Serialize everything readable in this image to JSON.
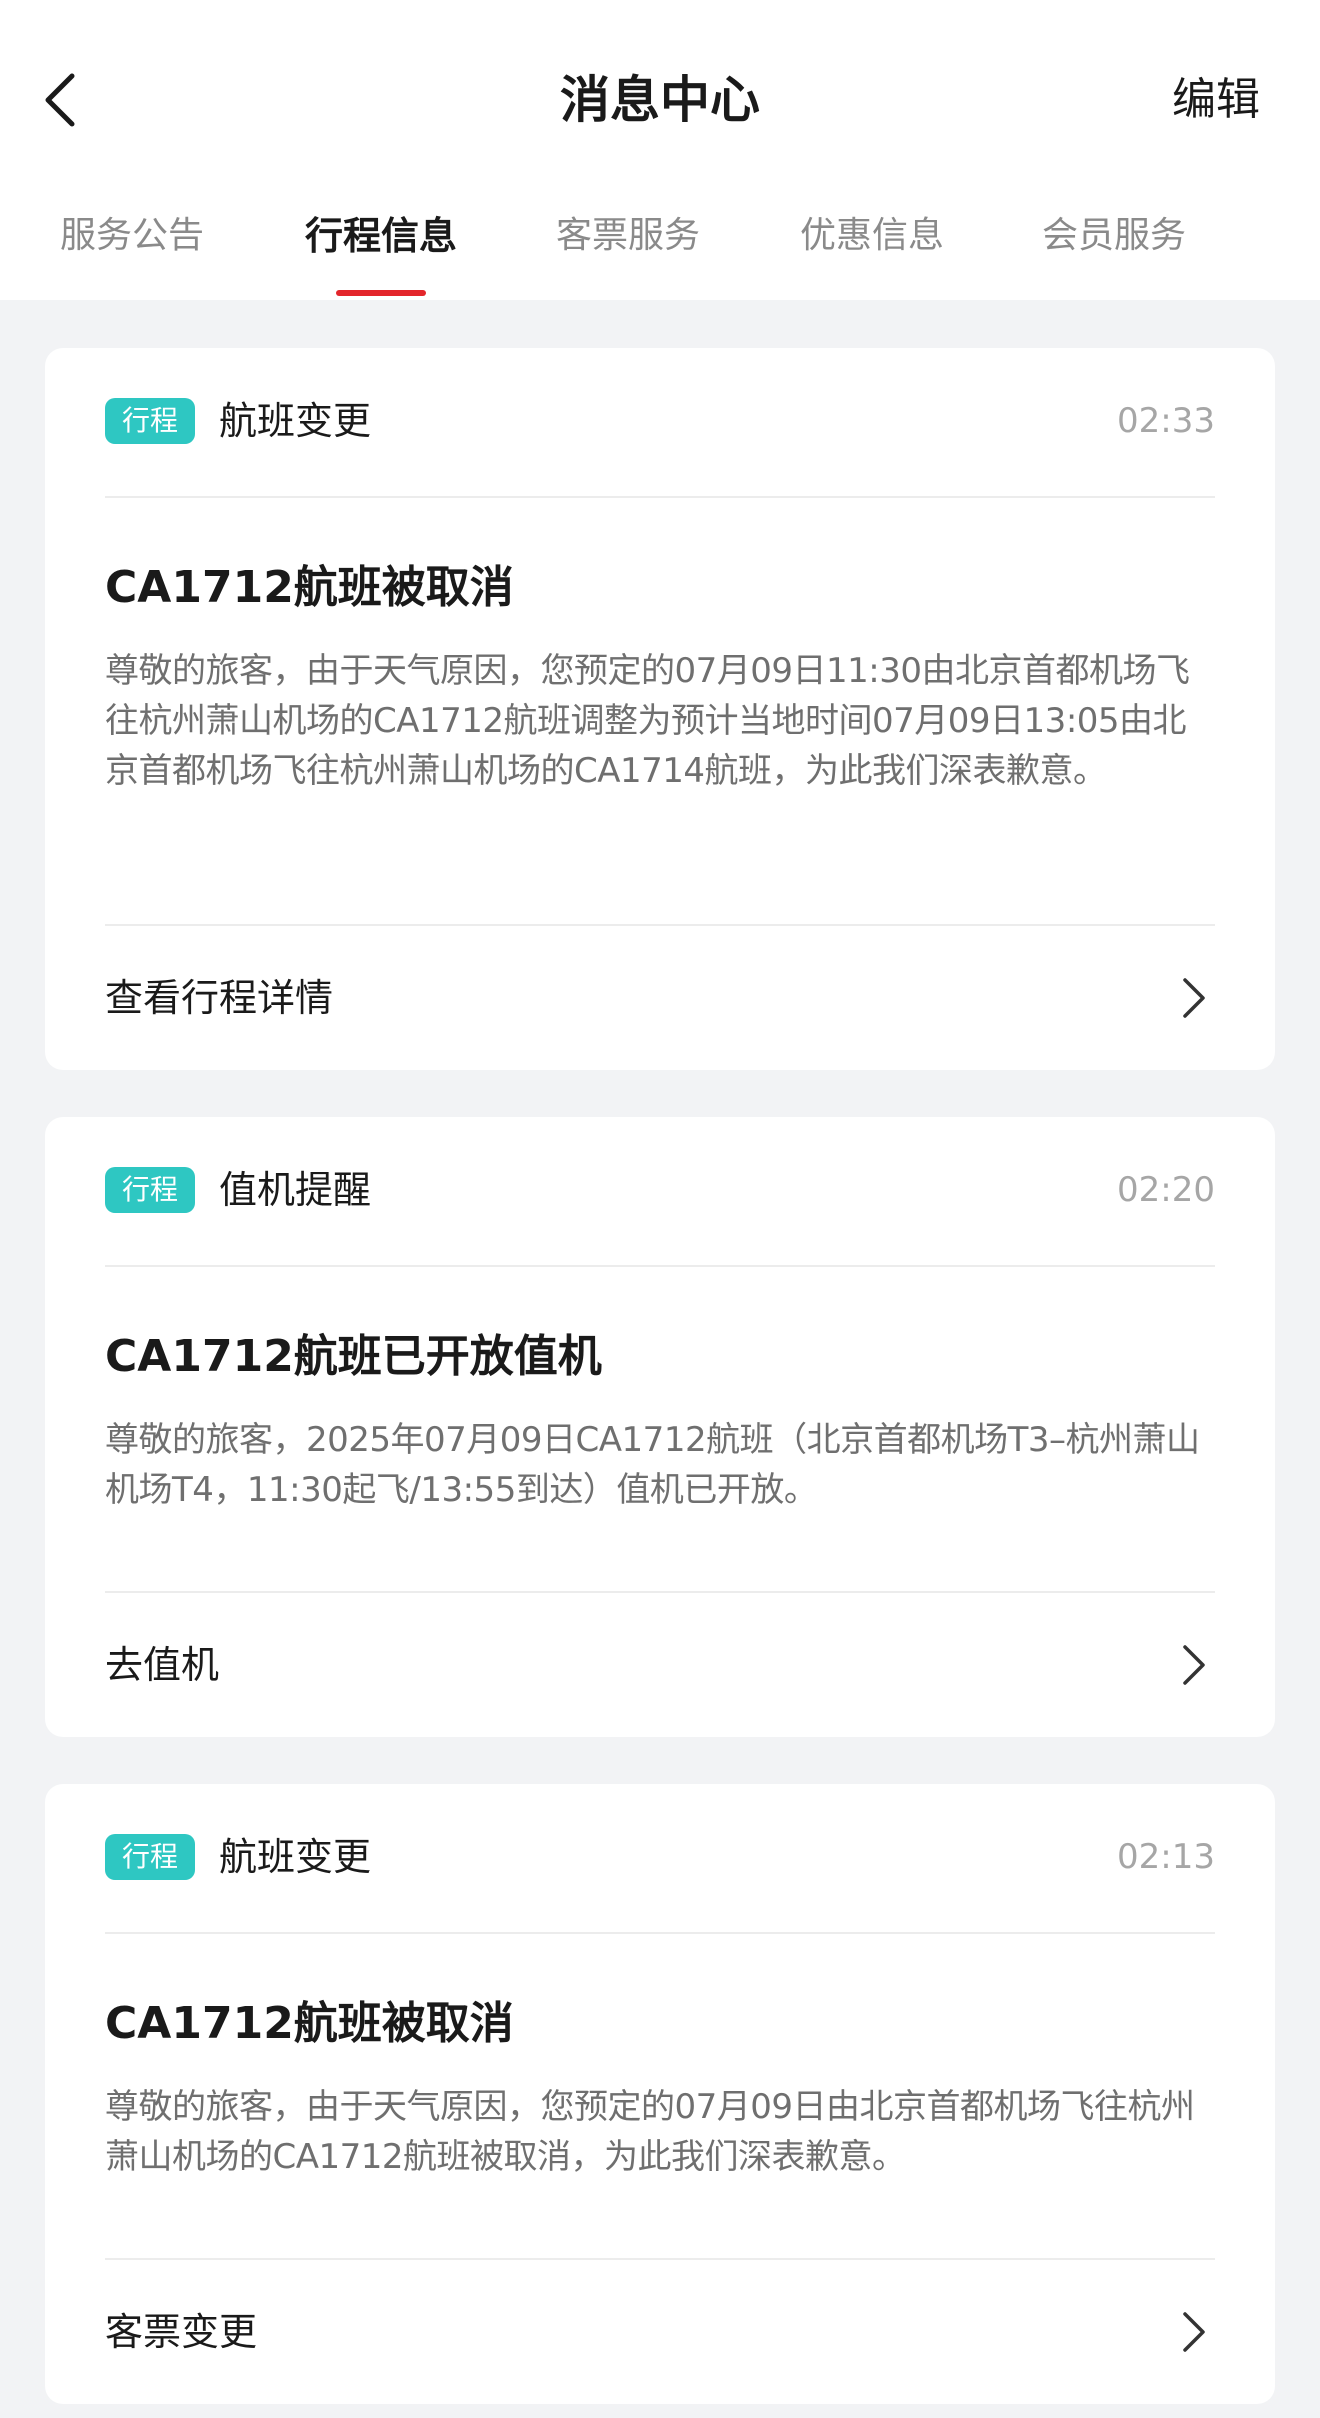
{
  "header": {
    "title": "消息中心",
    "edit_label": "编辑",
    "back_icon": "chevron-left-icon"
  },
  "tabs": [
    {
      "label": "服务公告",
      "active": false
    },
    {
      "label": "行程信息",
      "active": true
    },
    {
      "label": "客票服务",
      "active": false
    },
    {
      "label": "优惠信息",
      "active": false
    },
    {
      "label": "会员服务",
      "active": false
    }
  ],
  "colors": {
    "accent_red": "#e3262b",
    "badge_teal": "#2ec7c2",
    "background": "#f2f3f5"
  },
  "messages": [
    {
      "badge": "行程",
      "category": "航班变更",
      "time": "02:33",
      "title": "CA1712航班被取消",
      "text": "尊敬的旅客，由于天气原因，您预定的07月09日11:30由北京首都机场飞往杭州萧山机场的CA1712航班调整为预计当地时间07月09日13:05由北京首都机场飞往杭州萧山机场的CA1714航班，为此我们深表歉意。",
      "action": "查看行程详情"
    },
    {
      "badge": "行程",
      "category": "值机提醒",
      "time": "02:20",
      "title": "CA1712航班已开放值机",
      "text": "尊敬的旅客，2025年07月09日CA1712航班（北京首都机场T3–杭州萧山机场T4，11:30起飞/13:55到达）值机已开放。",
      "action": "去值机"
    },
    {
      "badge": "行程",
      "category": "航班变更",
      "time": "02:13",
      "title": "CA1712航班被取消",
      "text": "尊敬的旅客，由于天气原因，您预定的07月09日由北京首都机场飞往杭州萧山机场的CA1712航班被取消，为此我们深表歉意。",
      "action": "客票变更"
    }
  ]
}
